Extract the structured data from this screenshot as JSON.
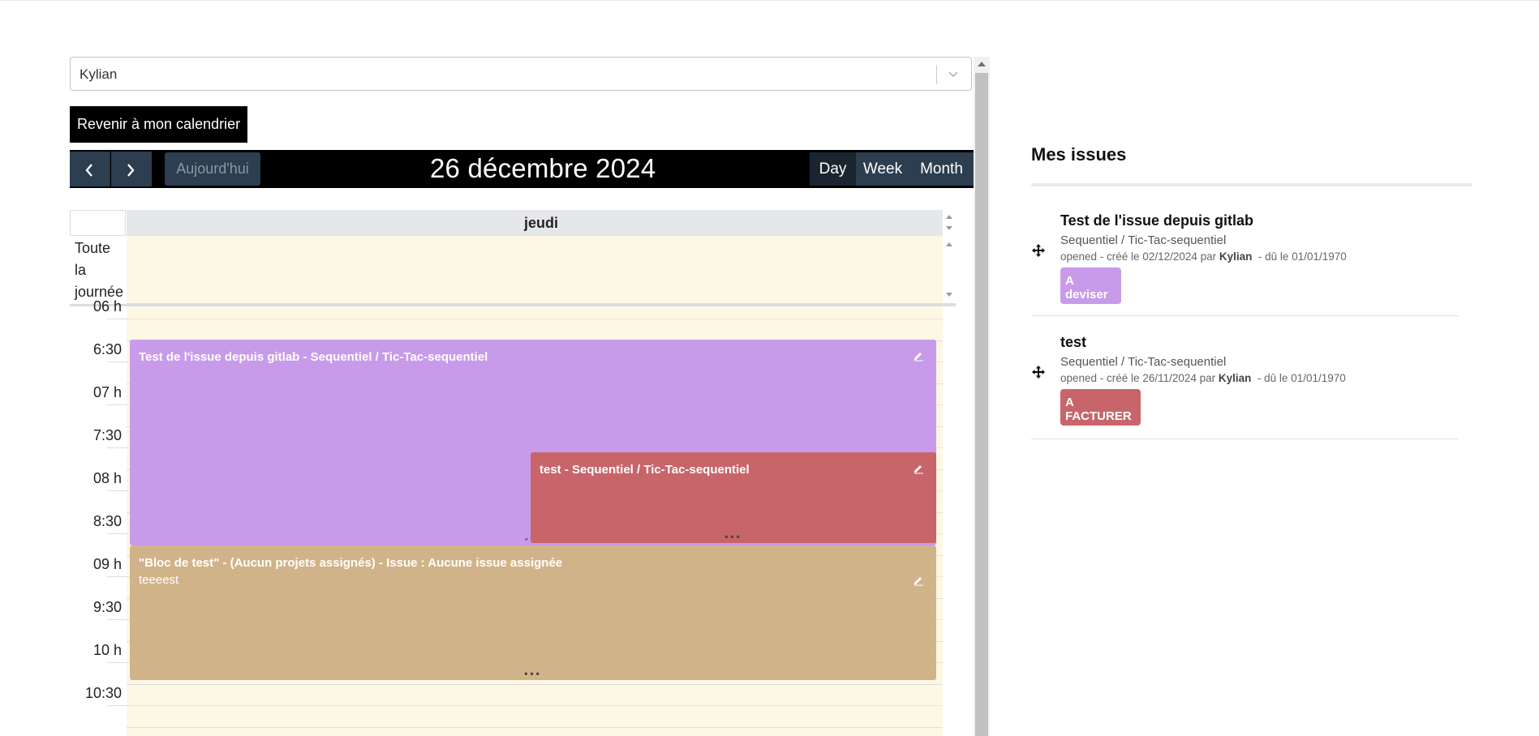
{
  "user_select": {
    "value": "Kylian"
  },
  "back_button_label": "Revenir à mon calendrier",
  "toolbar": {
    "today_label": "Aujourd'hui",
    "title": "26 décembre 2024",
    "views": {
      "day": "Day",
      "week": "Week",
      "month": "Month"
    },
    "active_view": "Day"
  },
  "calendar": {
    "day_header": "jeudi",
    "allday_label": [
      "Toute",
      "la",
      "journée"
    ],
    "time_labels": [
      "06 h",
      "6:30",
      "07 h",
      "7:30",
      "08 h",
      "8:30",
      "09 h",
      "9:30",
      "10 h",
      "10:30"
    ],
    "events": [
      {
        "title": "Test de l'issue depuis gitlab - Sequentiel / Tic-Tac-sequentiel",
        "color": "#c89bea"
      },
      {
        "title": "test - Sequentiel / Tic-Tac-sequentiel",
        "color": "#c8656a"
      },
      {
        "title": "\"Bloc de test\" - (Aucun projets assignés) - Issue : Aucune issue assignée",
        "description": "teeeest",
        "color": "#d1b38a"
      }
    ],
    "more_dots": "•••",
    "more_dots_small": "•"
  },
  "issues": {
    "heading": "Mes issues",
    "items": [
      {
        "title": "Test de l'issue depuis gitlab",
        "project": "Sequentiel / Tic-Tac-sequentiel",
        "meta_prefix": "opened - créé le 02/12/2024 par ",
        "author": "Kylian",
        "meta_suffix": "  - dû le 01/01/1970",
        "badge": "A deviser",
        "badge_color": "#c89bea"
      },
      {
        "title": "test",
        "project": "Sequentiel / Tic-Tac-sequentiel",
        "meta_prefix": "opened - créé le 26/11/2024 par ",
        "author": "Kylian",
        "meta_suffix": "  - dû le 01/01/1970",
        "badge": "A FACTURER",
        "badge_color": "#c8656a"
      }
    ]
  }
}
